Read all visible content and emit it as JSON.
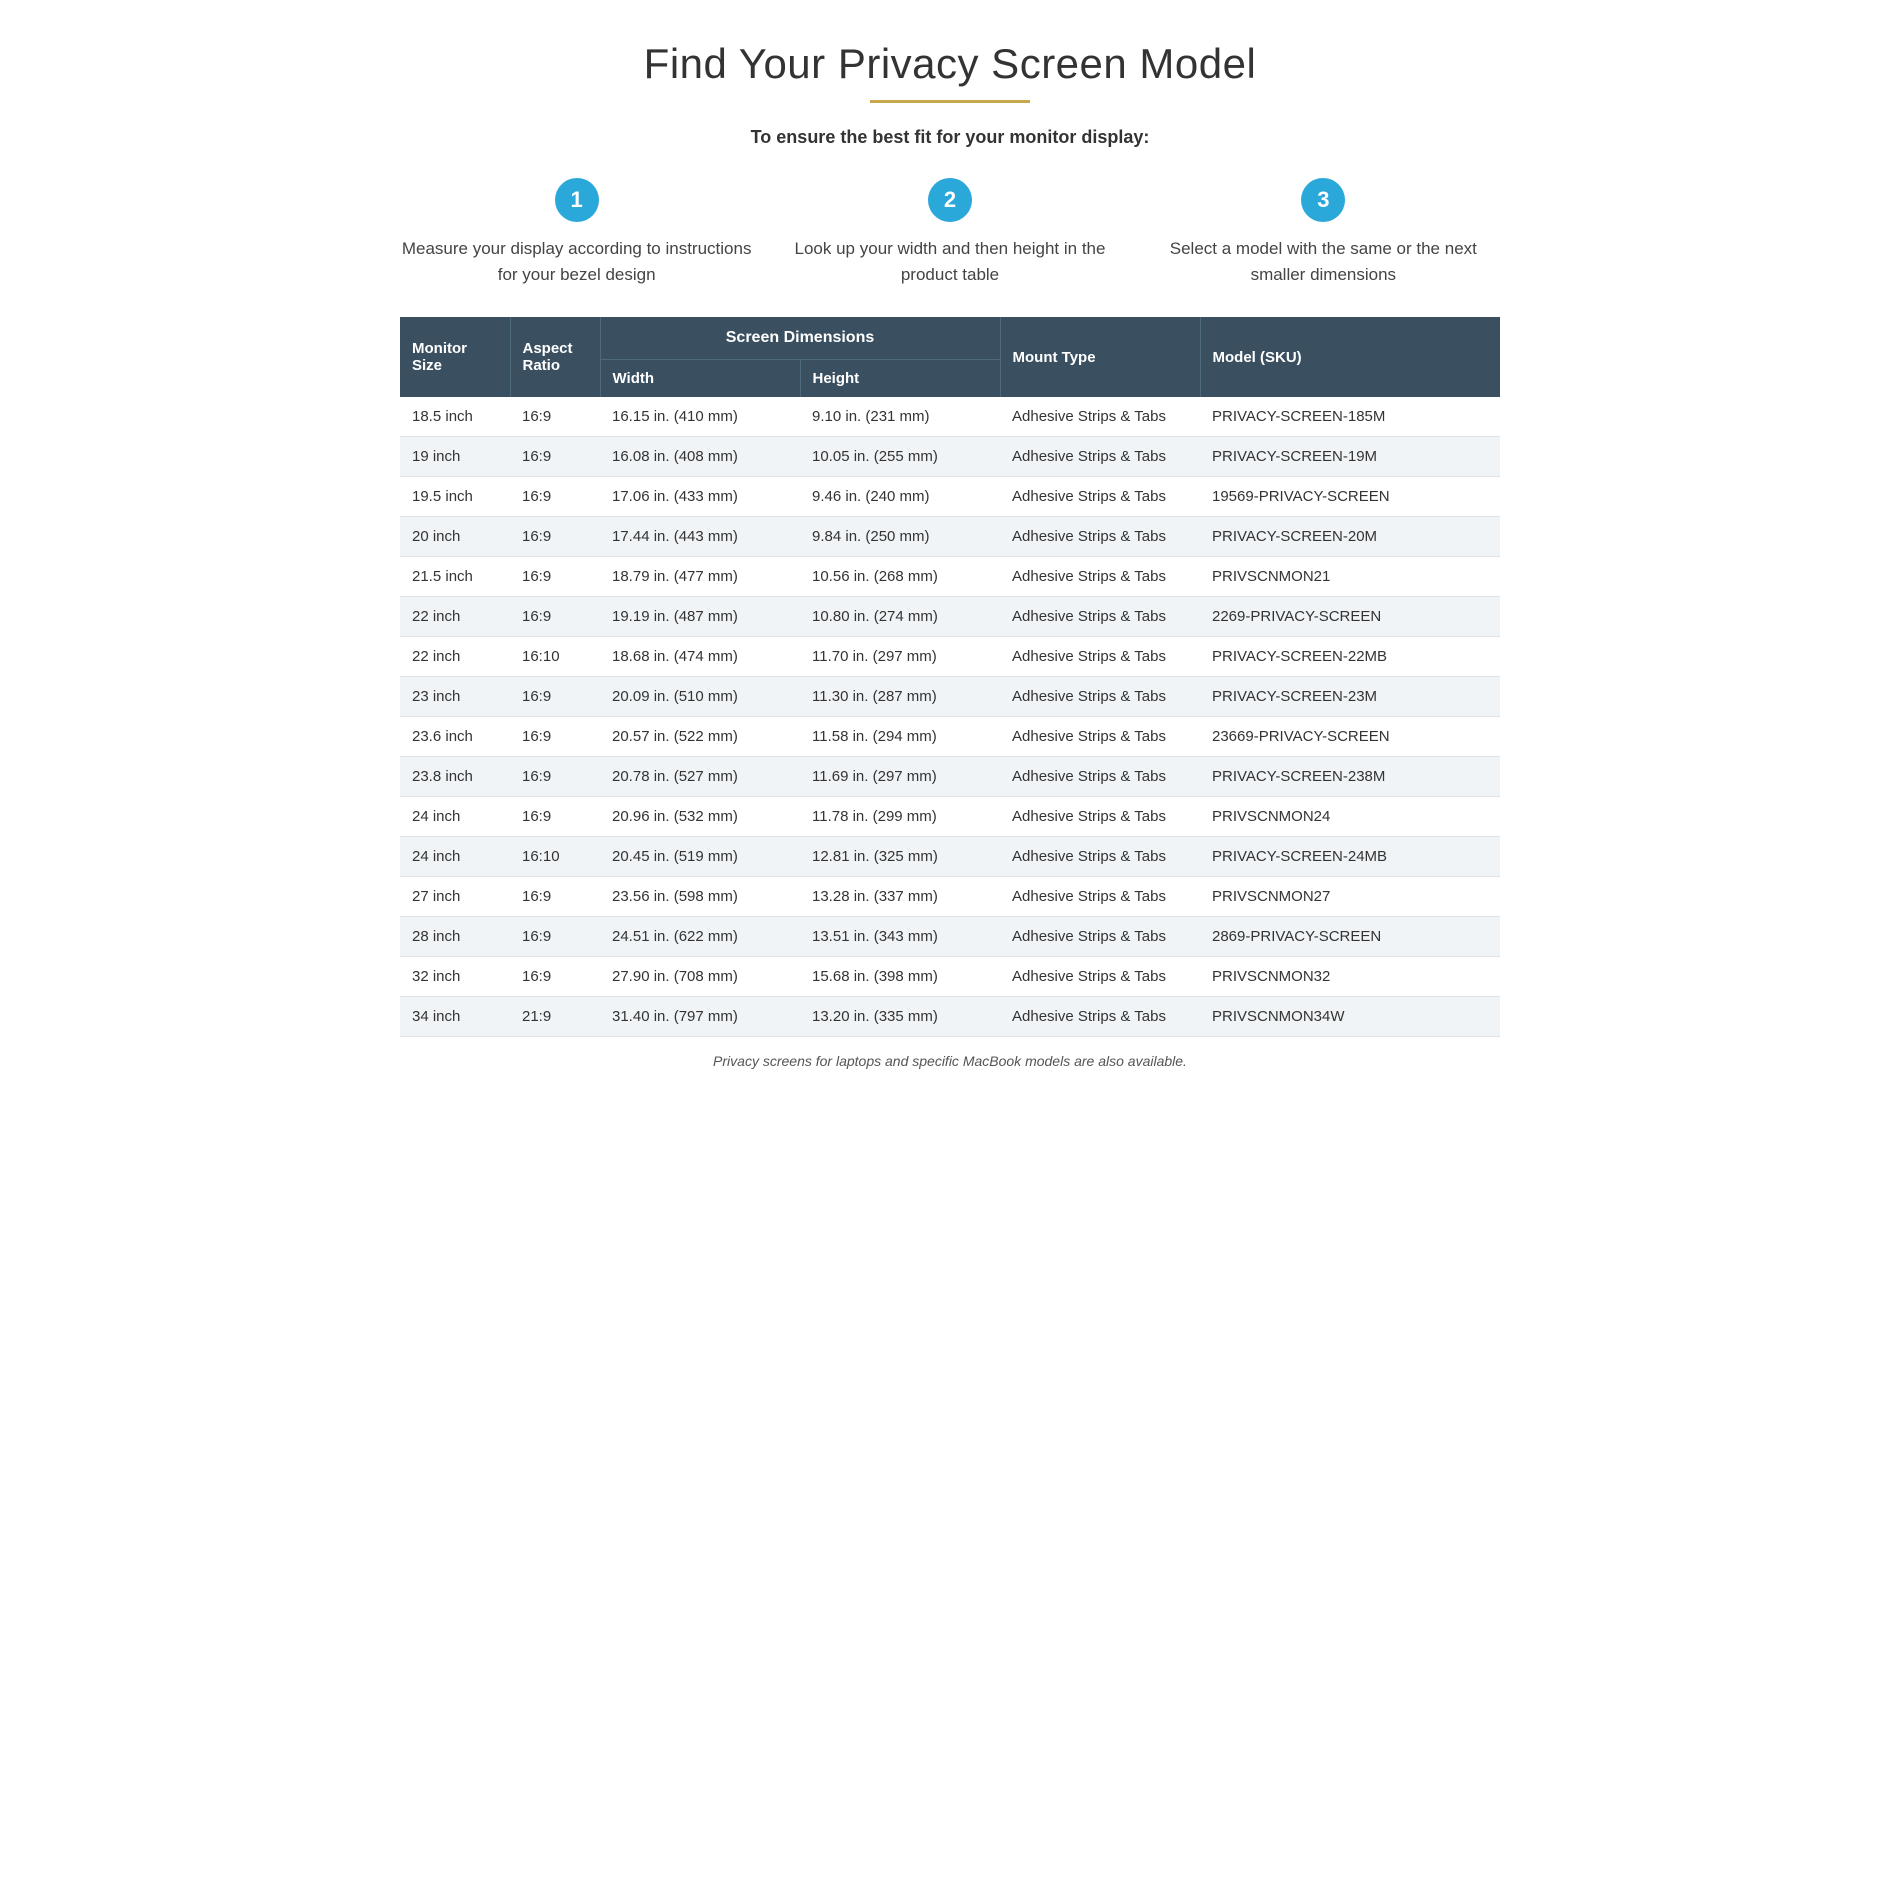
{
  "page": {
    "main_title": "Find Your Privacy Screen Model",
    "gold_divider": true,
    "subtitle": "To ensure the best fit for your monitor display:",
    "steps": [
      {
        "number": "1",
        "text": "Measure your display according to instructions for your bezel design"
      },
      {
        "number": "2",
        "text": "Look up your width and then height in the product table"
      },
      {
        "number": "3",
        "text": "Select a model with the same or the next smaller dimensions"
      }
    ],
    "table": {
      "header_group": "Screen Dimensions",
      "columns": [
        "Monitor Size",
        "Aspect Ratio",
        "Width",
        "Height",
        "Mount Type",
        "Model (SKU)"
      ],
      "rows": [
        {
          "size": "18.5 inch",
          "aspect": "16:9",
          "width": "16.15 in. (410 mm)",
          "height": "9.10 in. (231 mm)",
          "mount": "Adhesive Strips & Tabs",
          "sku": "PRIVACY-SCREEN-185M"
        },
        {
          "size": "19 inch",
          "aspect": "16:9",
          "width": "16.08 in. (408 mm)",
          "height": "10.05 in. (255 mm)",
          "mount": "Adhesive Strips & Tabs",
          "sku": "PRIVACY-SCREEN-19M"
        },
        {
          "size": "19.5 inch",
          "aspect": "16:9",
          "width": "17.06 in. (433 mm)",
          "height": "9.46 in. (240 mm)",
          "mount": "Adhesive Strips & Tabs",
          "sku": "19569-PRIVACY-SCREEN"
        },
        {
          "size": "20 inch",
          "aspect": "16:9",
          "width": "17.44 in. (443 mm)",
          "height": "9.84 in. (250 mm)",
          "mount": "Adhesive Strips & Tabs",
          "sku": "PRIVACY-SCREEN-20M"
        },
        {
          "size": "21.5 inch",
          "aspect": "16:9",
          "width": "18.79 in. (477 mm)",
          "height": "10.56 in. (268 mm)",
          "mount": "Adhesive Strips & Tabs",
          "sku": "PRIVSCNMON21"
        },
        {
          "size": "22 inch",
          "aspect": "16:9",
          "width": "19.19 in. (487 mm)",
          "height": "10.80 in. (274 mm)",
          "mount": "Adhesive Strips & Tabs",
          "sku": "2269-PRIVACY-SCREEN"
        },
        {
          "size": "22 inch",
          "aspect": "16:10",
          "width": "18.68 in. (474 mm)",
          "height": "11.70 in. (297 mm)",
          "mount": "Adhesive Strips & Tabs",
          "sku": "PRIVACY-SCREEN-22MB"
        },
        {
          "size": "23 inch",
          "aspect": "16:9",
          "width": "20.09 in. (510 mm)",
          "height": "11.30 in. (287 mm)",
          "mount": "Adhesive Strips & Tabs",
          "sku": "PRIVACY-SCREEN-23M"
        },
        {
          "size": "23.6 inch",
          "aspect": "16:9",
          "width": "20.57 in. (522 mm)",
          "height": "11.58 in. (294 mm)",
          "mount": "Adhesive Strips & Tabs",
          "sku": "23669-PRIVACY-SCREEN"
        },
        {
          "size": "23.8 inch",
          "aspect": "16:9",
          "width": "20.78 in. (527 mm)",
          "height": "11.69 in. (297 mm)",
          "mount": "Adhesive Strips & Tabs",
          "sku": "PRIVACY-SCREEN-238M"
        },
        {
          "size": "24 inch",
          "aspect": "16:9",
          "width": "20.96 in. (532 mm)",
          "height": "11.78 in. (299 mm)",
          "mount": "Adhesive Strips & Tabs",
          "sku": "PRIVSCNMON24"
        },
        {
          "size": "24 inch",
          "aspect": "16:10",
          "width": "20.45 in. (519 mm)",
          "height": "12.81 in. (325 mm)",
          "mount": "Adhesive Strips & Tabs",
          "sku": "PRIVACY-SCREEN-24MB"
        },
        {
          "size": "27 inch",
          "aspect": "16:9",
          "width": "23.56 in. (598 mm)",
          "height": "13.28 in. (337 mm)",
          "mount": "Adhesive Strips & Tabs",
          "sku": "PRIVSCNMON27"
        },
        {
          "size": "28 inch",
          "aspect": "16:9",
          "width": "24.51 in. (622 mm)",
          "height": "13.51 in. (343 mm)",
          "mount": "Adhesive Strips & Tabs",
          "sku": "2869-PRIVACY-SCREEN"
        },
        {
          "size": "32 inch",
          "aspect": "16:9",
          "width": "27.90 in. (708 mm)",
          "height": "15.68 in. (398 mm)",
          "mount": "Adhesive Strips & Tabs",
          "sku": "PRIVSCNMON32"
        },
        {
          "size": "34 inch",
          "aspect": "21:9",
          "width": "31.40 in. (797 mm)",
          "height": "13.20 in. (335 mm)",
          "mount": "Adhesive Strips & Tabs",
          "sku": "PRIVSCNMON34W"
        }
      ]
    },
    "footer_note": "Privacy screens for laptops and specific MacBook models are also available."
  }
}
